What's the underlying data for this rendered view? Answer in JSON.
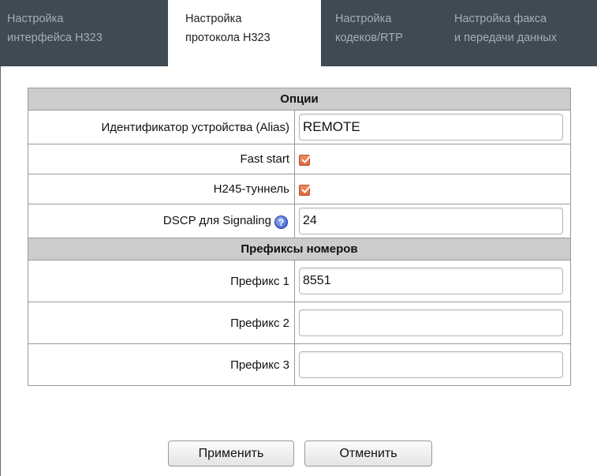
{
  "tabs": [
    {
      "line1": "Настройка",
      "line2": "интерфейса H323",
      "active": false
    },
    {
      "line1": "Настройка",
      "line2": "протокола H323",
      "active": true
    },
    {
      "line1": "Настройка",
      "line2": "кодеков/RTP",
      "active": false
    },
    {
      "line1": "Настройка факса",
      "line2": "и передачи данных",
      "active": false
    }
  ],
  "options": {
    "header": "Опции",
    "alias_label": "Идентификатор устройства (Alias)",
    "alias_value": "REMOTE",
    "fast_start_label": "Fast start",
    "fast_start_checked": true,
    "h245_label": "H245-туннель",
    "h245_checked": true,
    "dscp_label": "DSCP для Signaling",
    "dscp_value": "24"
  },
  "prefixes": {
    "header": "Префиксы номеров",
    "items": [
      {
        "label": "Префикс 1",
        "value": "8551"
      },
      {
        "label": "Префикс 2",
        "value": ""
      },
      {
        "label": "Префикс 3",
        "value": ""
      }
    ]
  },
  "buttons": {
    "apply": "Применить",
    "cancel": "Отменить"
  },
  "icons": {
    "help": "help-icon",
    "checkbox": "checkbox-checked"
  },
  "colors": {
    "tabbar_bg": "#3f4a52",
    "tab_text_inactive": "#a4aeb6",
    "header_bg": "#cccccc",
    "checkbox_accent": "#e0683c"
  }
}
